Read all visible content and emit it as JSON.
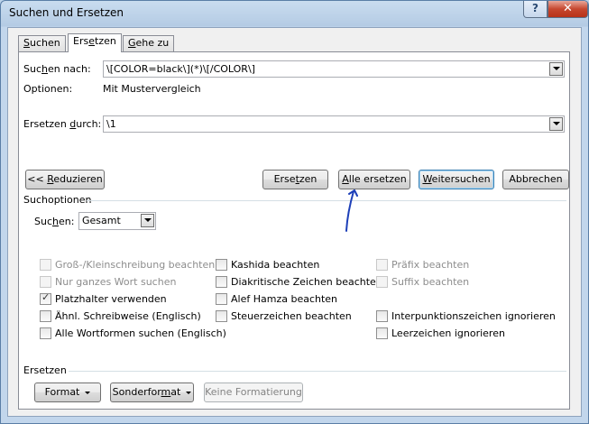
{
  "window": {
    "title": "Suchen und Ersetzen",
    "help_glyph": "?",
    "close_glyph": "✕"
  },
  "tabs": [
    {
      "label_u": "S",
      "label_rest": "uchen"
    },
    {
      "label_pre": "Ers",
      "label_u": "e",
      "label_rest": "tzen"
    },
    {
      "label_u": "G",
      "label_rest": "ehe zu"
    }
  ],
  "search": {
    "label_pre": "Suc",
    "label_u": "h",
    "label_rest": "en nach:",
    "value": "\\[COLOR=black\\](*)\\[/COLOR\\]",
    "options_label": "Optionen:",
    "options_value": "Mit Mustervergleich"
  },
  "replace": {
    "label_pre": "Ersetzen ",
    "label_u": "d",
    "label_rest": "urch:",
    "value": "\\1"
  },
  "buttons": {
    "reduce_pre": "<< ",
    "reduce_u": "R",
    "reduce_rest": "eduzieren",
    "replace_pre": "Erse",
    "replace_u": "t",
    "replace_rest": "zen",
    "replace_all_u": "A",
    "replace_all_rest": "lle ersetzen",
    "find_next_u": "W",
    "find_next_rest": "eitersuchen",
    "cancel": "Abbrechen"
  },
  "search_options": {
    "heading": "Suchoptionen",
    "search_label_pre": "Suc",
    "search_label_u": "h",
    "search_label_rest": "en:",
    "search_value": "Gesamt",
    "col1": [
      {
        "label": "Groß-/Kleinschreibung beachten",
        "checked": false,
        "disabled": true
      },
      {
        "label": "Nur ganzes Wort suchen",
        "checked": false,
        "disabled": true
      },
      {
        "label": "Platzhalter verwenden",
        "checked": true,
        "disabled": false
      },
      {
        "label": "Ähnl. Schreibweise (Englisch)",
        "checked": false,
        "disabled": false
      },
      {
        "label": "Alle Wortformen suchen (Englisch)",
        "checked": false,
        "disabled": false
      }
    ],
    "col2": [
      {
        "label": "Kashida beachten",
        "checked": false,
        "disabled": false
      },
      {
        "label": "Diakritische Zeichen beachten",
        "checked": false,
        "disabled": false
      },
      {
        "label": "Alef Hamza beachten",
        "checked": false,
        "disabled": false
      },
      {
        "label": "Steuerzeichen beachten",
        "checked": false,
        "disabled": false
      }
    ],
    "col3": [
      {
        "label": "Präfix beachten",
        "checked": false,
        "disabled": true
      },
      {
        "label": "Suffix beachten",
        "checked": false,
        "disabled": true
      },
      {
        "label": "Interpunktionszeichen ignorieren",
        "checked": false,
        "disabled": false
      },
      {
        "label": "Leerzeichen ignorieren",
        "checked": false,
        "disabled": false
      }
    ]
  },
  "replace_section": {
    "heading": "Ersetzen",
    "format": "Format",
    "special_pre": "Sonderfor",
    "special_u": "m",
    "special_rest": "at",
    "no_format": "Keine Formatierung"
  },
  "check_glyph": "✓",
  "colors": {
    "annotation": "#1d3fb8",
    "title_bar": "#b4cbe4",
    "close_button": "#c6472f"
  }
}
